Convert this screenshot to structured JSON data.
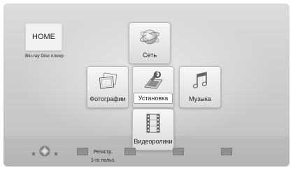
{
  "home": {
    "label": "HOME",
    "subtitle": "Blu-ray Disc плеер"
  },
  "menu": {
    "network": {
      "label": "Сеть",
      "icon": "globe-icon"
    },
    "photos": {
      "label": "Фотографии",
      "icon": "photo-frames-icon"
    },
    "setup": {
      "label": "Установка",
      "icon": "setup-tools-icon"
    },
    "music": {
      "label": "Музыка",
      "icon": "music-notes-icon"
    },
    "videos": {
      "label": "Видеоролики",
      "icon": "film-strip-icon"
    },
    "selected": "setup"
  },
  "footer": {
    "nav_icon": "navigation-pad-icon",
    "registration_label": "Регистр.\n1-го польз."
  }
}
